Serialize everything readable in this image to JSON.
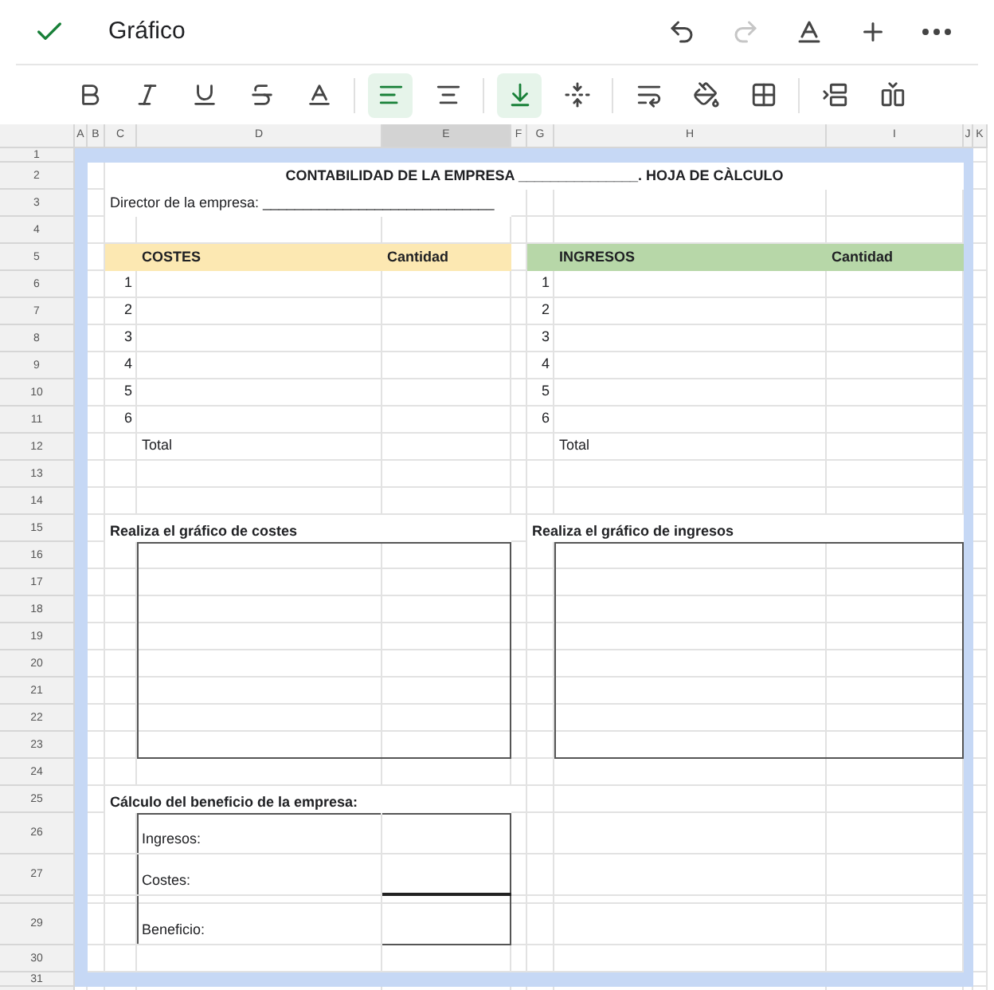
{
  "app_bar": {
    "title": "Gráfico",
    "actions": [
      {
        "kind": "undo",
        "disabled": false
      },
      {
        "kind": "redo",
        "disabled": true
      },
      {
        "kind": "text_format",
        "disabled": false
      },
      {
        "kind": "add",
        "disabled": false
      },
      {
        "kind": "more",
        "disabled": false
      }
    ]
  },
  "toolbar": [
    {
      "kind": "bold",
      "selected": false
    },
    {
      "kind": "italic",
      "selected": false
    },
    {
      "kind": "underline",
      "selected": false
    },
    {
      "kind": "strikethrough",
      "selected": false
    },
    {
      "kind": "text_color",
      "selected": false
    },
    {
      "kind": "align_left",
      "selected": true
    },
    {
      "kind": "align_center",
      "selected": false
    },
    {
      "kind": "valign_bottom",
      "selected": true
    },
    {
      "kind": "valign_middle",
      "selected": false
    },
    {
      "kind": "wrap",
      "selected": false
    },
    {
      "kind": "fill_color",
      "selected": false
    },
    {
      "kind": "borders",
      "selected": false
    },
    {
      "kind": "insert_row",
      "selected": false
    },
    {
      "kind": "insert_column",
      "selected": false
    }
  ],
  "column_headers": [
    {
      "label": "A",
      "selected": false
    },
    {
      "label": "B",
      "selected": false
    },
    {
      "label": "C",
      "selected": false
    },
    {
      "label": "D",
      "selected": false
    },
    {
      "label": "E",
      "selected": true
    },
    {
      "label": "F",
      "selected": false
    },
    {
      "label": "G",
      "selected": false
    },
    {
      "label": "H",
      "selected": false
    },
    {
      "label": "I",
      "selected": false
    },
    {
      "label": "J",
      "selected": false
    },
    {
      "label": "K",
      "selected": false
    }
  ],
  "row_headers": [
    "1",
    "2",
    "3",
    "4",
    "5",
    "6",
    "7",
    "8",
    "9",
    "10",
    "11",
    "12",
    "13",
    "14",
    "15",
    "16",
    "17",
    "18",
    "19",
    "20",
    "21",
    "22",
    "23",
    "24",
    "25",
    "26",
    "27",
    "29",
    "30",
    "31"
  ],
  "sheet": {
    "title": "CONTABILIDAD DE LA EMPRESA _______________. HOJA DE CÀLCULO",
    "director": "Director de la empresa: _____________________________",
    "tables": [
      {
        "header": "COSTES",
        "amount_header": "Cantidad",
        "color": "#fce8b2",
        "numbers": [
          "1",
          "2",
          "3",
          "4",
          "5",
          "6"
        ],
        "total": "Total"
      },
      {
        "header": "INGRESOS",
        "amount_header": "Cantidad",
        "color": "#b7d7a8",
        "numbers": [
          "1",
          "2",
          "3",
          "4",
          "5",
          "6"
        ],
        "total": "Total"
      }
    ],
    "chart_prompts": [
      "Realiza el gráfico de costes",
      "Realiza el gráfico de ingresos"
    ],
    "profit": {
      "title": "Cálculo del beneficio de la empresa:",
      "lines": [
        "Ingresos:",
        "Costes:",
        "Beneficio:"
      ]
    }
  }
}
